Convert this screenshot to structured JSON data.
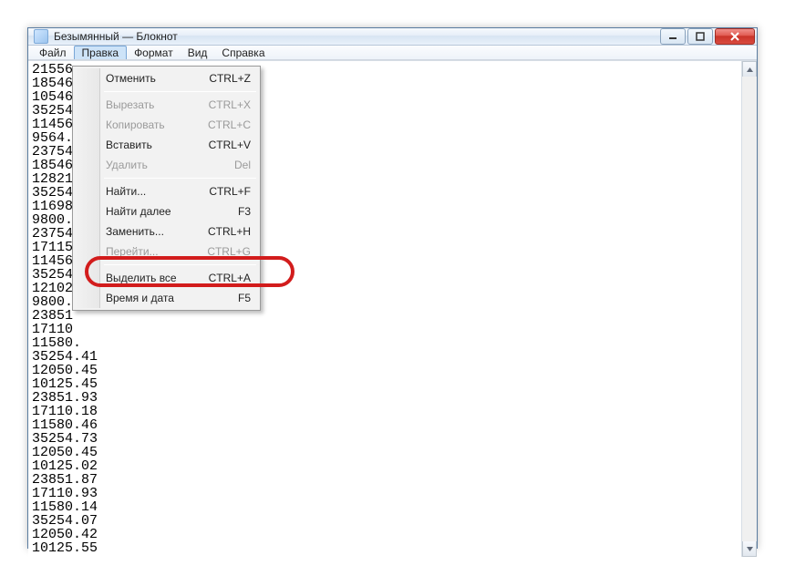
{
  "title": "Безымянный — Блокнот",
  "menubar": {
    "file": "Файл",
    "edit": "Правка",
    "format": "Формат",
    "view": "Вид",
    "help": "Справка"
  },
  "edit_menu": {
    "undo": {
      "label": "Отменить",
      "shortcut": "CTRL+Z",
      "enabled": true
    },
    "cut": {
      "label": "Вырезать",
      "shortcut": "CTRL+X",
      "enabled": false
    },
    "copy": {
      "label": "Копировать",
      "shortcut": "CTRL+C",
      "enabled": false
    },
    "paste": {
      "label": "Вставить",
      "shortcut": "CTRL+V",
      "enabled": true
    },
    "delete": {
      "label": "Удалить",
      "shortcut": "Del",
      "enabled": false
    },
    "find": {
      "label": "Найти...",
      "shortcut": "CTRL+F",
      "enabled": true
    },
    "find_next": {
      "label": "Найти далее",
      "shortcut": "F3",
      "enabled": true
    },
    "replace": {
      "label": "Заменить...",
      "shortcut": "CTRL+H",
      "enabled": true
    },
    "goto": {
      "label": "Перейти...",
      "shortcut": "CTRL+G",
      "enabled": false
    },
    "select_all": {
      "label": "Выделить все",
      "shortcut": "CTRL+A",
      "enabled": true
    },
    "time_date": {
      "label": "Время и дата",
      "shortcut": "F5",
      "enabled": true
    }
  },
  "text_lines": [
    "21556",
    "18546",
    "10546",
    "35254",
    "11456",
    "9564.",
    "23754",
    "18546",
    "12821",
    "35254",
    "11698",
    "9800.",
    "23754",
    "17115",
    "11456",
    "35254",
    "12102",
    "9800.",
    "23851",
    "17110",
    "11580.",
    "35254.41",
    "12050.45",
    "10125.45",
    "23851.93",
    "17110.18",
    "11580.46",
    "35254.73",
    "12050.45",
    "10125.02",
    "23851.87",
    "17110.93",
    "11580.14",
    "35254.07",
    "12050.42",
    "10125.55"
  ]
}
